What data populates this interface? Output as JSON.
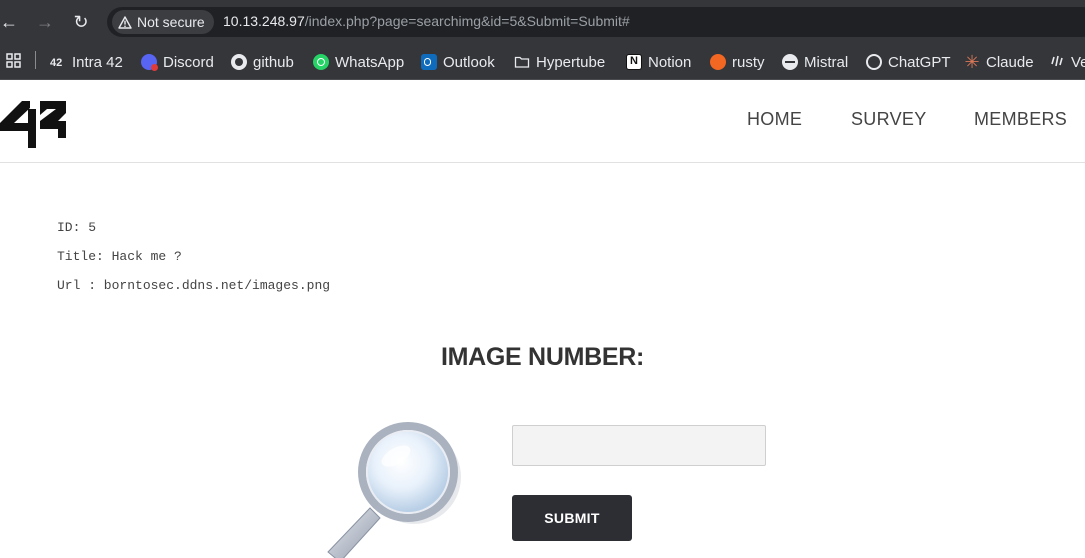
{
  "browser": {
    "security_chip": "Not secure",
    "url_host": "10.13.248.97",
    "url_path": "/index.php?page=searchimg&id=5&Submit=Submit#",
    "bookmarks": [
      {
        "label": "Intra 42",
        "icon": "intra42-icon"
      },
      {
        "label": "Discord",
        "icon": "discord-icon"
      },
      {
        "label": "github",
        "icon": "github-icon"
      },
      {
        "label": "WhatsApp",
        "icon": "whatsapp-icon"
      },
      {
        "label": "Outlook",
        "icon": "outlook-icon"
      },
      {
        "label": "Hypertube",
        "icon": "folder-icon"
      },
      {
        "label": "Notion",
        "icon": "notion-icon"
      },
      {
        "label": "rusty",
        "icon": "rusty-icon"
      },
      {
        "label": "Mistral",
        "icon": "mistral-icon"
      },
      {
        "label": "ChatGPT",
        "icon": "chatgpt-icon"
      },
      {
        "label": "Claude",
        "icon": "claude-icon"
      },
      {
        "label": "Ve",
        "icon": "waveform-icon"
      }
    ]
  },
  "site": {
    "nav": [
      "HOME",
      "SURVEY",
      "MEMBERS"
    ]
  },
  "result": {
    "id_line": "ID: 5",
    "title_line": "Title: Hack me ?",
    "url_line": "Url : borntosec.ddns.net/images.png"
  },
  "form": {
    "title": "IMAGE NUMBER:",
    "input_value": "",
    "submit_label": "SUBMIT"
  },
  "colors": {
    "chrome": "#35363a",
    "omnibox": "#202124",
    "submit_bg": "#2c2e34",
    "text": "#444444"
  }
}
